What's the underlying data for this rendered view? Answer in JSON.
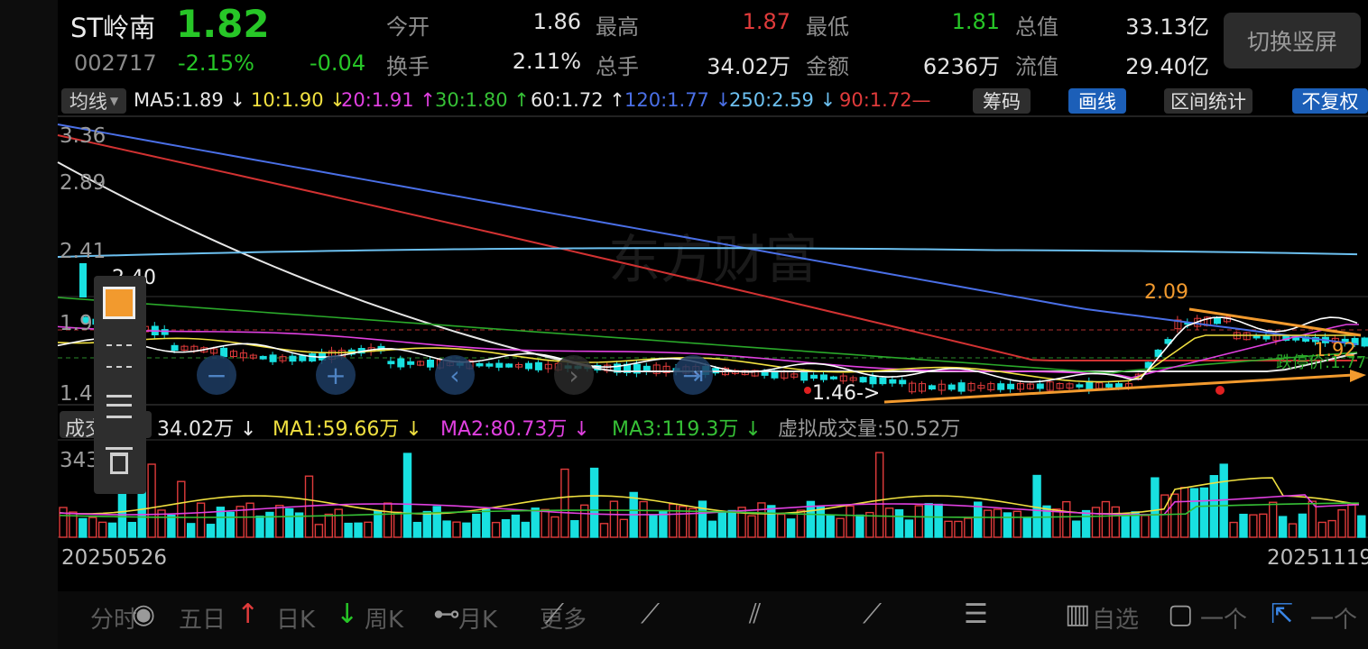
{
  "header": {
    "name": "ST岭南",
    "price": "1.82",
    "code": "002717",
    "pct": "-2.15%",
    "change": "-0.04",
    "stats": [
      {
        "label": "今开",
        "value": "1.86",
        "color": "normal"
      },
      {
        "label": "最高",
        "value": "1.87",
        "color": "red"
      },
      {
        "label": "最低",
        "value": "1.81",
        "color": "green"
      },
      {
        "label": "总值",
        "value": "33.13亿",
        "color": "normal"
      },
      {
        "label": "换手",
        "value": "2.11%",
        "color": "normal"
      },
      {
        "label": "总手",
        "value": "34.02万",
        "color": "normal"
      },
      {
        "label": "金额",
        "value": "6236万",
        "color": "normal"
      },
      {
        "label": "流值",
        "value": "29.40亿",
        "color": "normal"
      }
    ],
    "switch_button": "切换竖屏"
  },
  "ma_bar": {
    "selector": "均线",
    "items": [
      {
        "text": "MA5:1.89 ↓",
        "color": "#e6e6e6"
      },
      {
        "text": "10:1.90 ↓",
        "color": "#f0e040"
      },
      {
        "text": "20:1.91 ↑",
        "color": "#e040e0"
      },
      {
        "text": "30:1.80 ↑",
        "color": "#36c036"
      },
      {
        "text": "60:1.72 ↑",
        "color": "#e6e6e6"
      },
      {
        "text": "120:1.77 ↓",
        "color": "#4a6fe6"
      },
      {
        "text": "250:2.59 ↓",
        "color": "#6cc0f0"
      },
      {
        "text": "90:1.72—",
        "color": "#e03b3b"
      }
    ],
    "buttons": [
      "筹码",
      "画线",
      "区间统计",
      "不复权"
    ]
  },
  "price_axis": [
    "3.36",
    "2.89",
    "2.41",
    "1.9",
    "1.46"
  ],
  "annotations": {
    "high_label": "2.09",
    "marker_240": "2.40",
    "low_marker": "1.46->",
    "right_price": "1.92",
    "limit_down": "跌停价:1.77",
    "watermark": "东方财富"
  },
  "volume_bar": {
    "label": "成交量",
    "items": [
      {
        "text": "34.02万 ↓",
        "color": "#e6e6e6"
      },
      {
        "text": "MA1:59.66万 ↓",
        "color": "#f0e040"
      },
      {
        "text": "MA2:80.73万 ↓",
        "color": "#e040e0"
      },
      {
        "text": "MA3:119.3万 ↓",
        "color": "#36c036"
      },
      {
        "text": "虚拟成交量:50.52万",
        "color": "#9a9a9a"
      }
    ],
    "axis_top": "343"
  },
  "dates": {
    "start": "20250526",
    "end": "20251119"
  },
  "bottom_bar": {
    "tabs": [
      "分时",
      "五日",
      "日K",
      "周K",
      "月K",
      "更多"
    ],
    "right_items": [
      "自选",
      "一个",
      "一个"
    ]
  },
  "colors": {
    "up": "#e03b3b",
    "down": "#18e0e0",
    "green_text": "#27c627",
    "accent_orange": "#f29a2e"
  }
}
